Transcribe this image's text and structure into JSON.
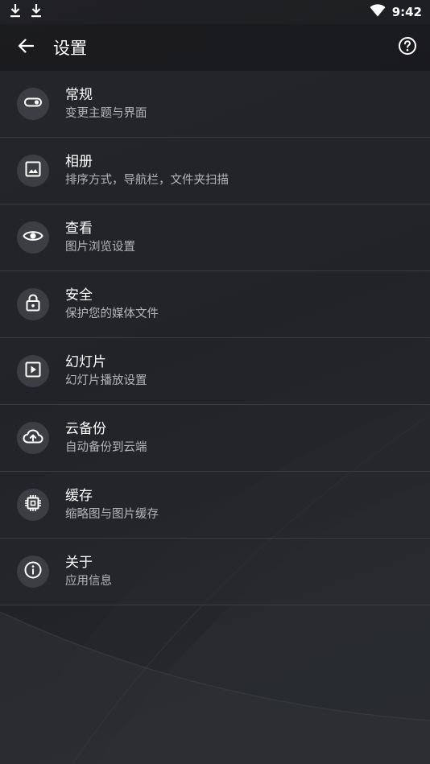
{
  "status_bar": {
    "time": "9:42",
    "icons": [
      "download-icon",
      "download-icon",
      "wifi-icon"
    ]
  },
  "toolbar": {
    "title": "设置",
    "back_icon": "arrow-back-icon",
    "help_icon": "help-circle-icon"
  },
  "settings": [
    {
      "key": "general",
      "icon": "toggle-icon",
      "title": "常规",
      "subtitle": "变更主题与界面"
    },
    {
      "key": "album",
      "icon": "image-icon",
      "title": "相册",
      "subtitle": "排序方式，导航栏，文件夹扫描"
    },
    {
      "key": "view",
      "icon": "eye-icon",
      "title": "查看",
      "subtitle": "图片浏览设置"
    },
    {
      "key": "security",
      "icon": "lock-icon",
      "title": "安全",
      "subtitle": "保护您的媒体文件"
    },
    {
      "key": "slideshow",
      "icon": "play-box-icon",
      "title": "幻灯片",
      "subtitle": "幻灯片播放设置"
    },
    {
      "key": "cloud-backup",
      "icon": "cloud-upload-icon",
      "title": "云备份",
      "subtitle": "自动备份到云端"
    },
    {
      "key": "cache",
      "icon": "chip-icon",
      "title": "缓存",
      "subtitle": "缩略图与图片缓存"
    },
    {
      "key": "about",
      "icon": "info-icon",
      "title": "关于",
      "subtitle": "应用信息"
    }
  ],
  "colors": {
    "background": "#1e1f22",
    "row_background": "#28292e",
    "icon_circle": "#3c3e43",
    "subtitle": "#b4b6ba",
    "divider": "#3a3c41"
  }
}
